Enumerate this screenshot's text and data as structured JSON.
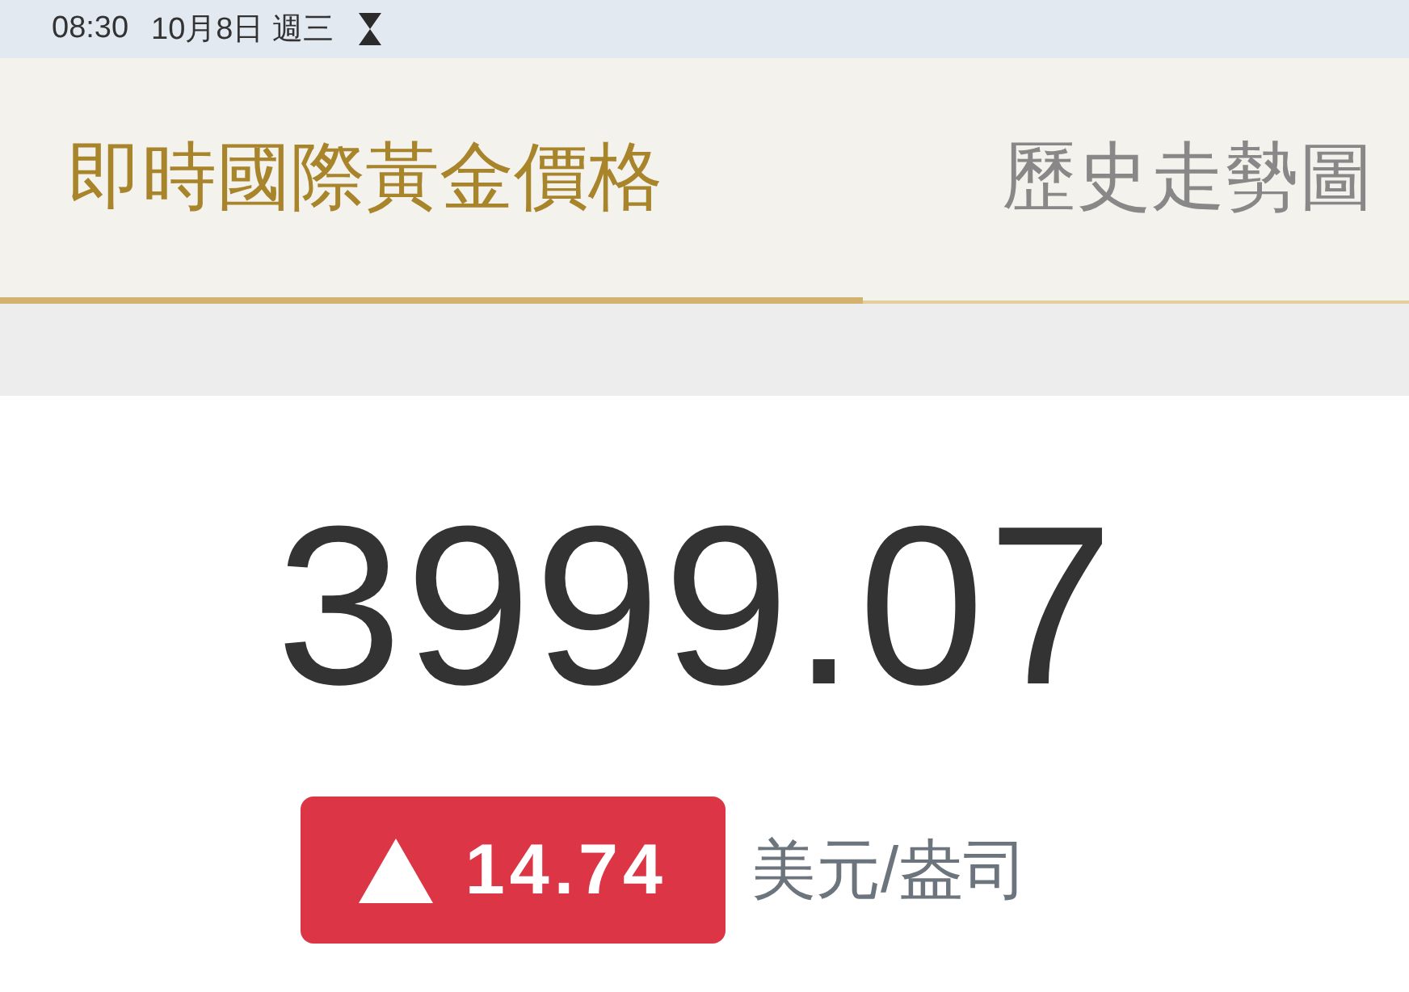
{
  "status_bar": {
    "time": "08:30",
    "date": "10月8日 週三"
  },
  "tabs": [
    {
      "label": "即時國際黃金價格",
      "selected": true
    },
    {
      "label": "歷史走勢圖",
      "selected": false
    }
  ],
  "price": {
    "value": "3999.07",
    "change": {
      "rising": true,
      "value": "14.74"
    },
    "unit": "美元/盎司"
  }
}
